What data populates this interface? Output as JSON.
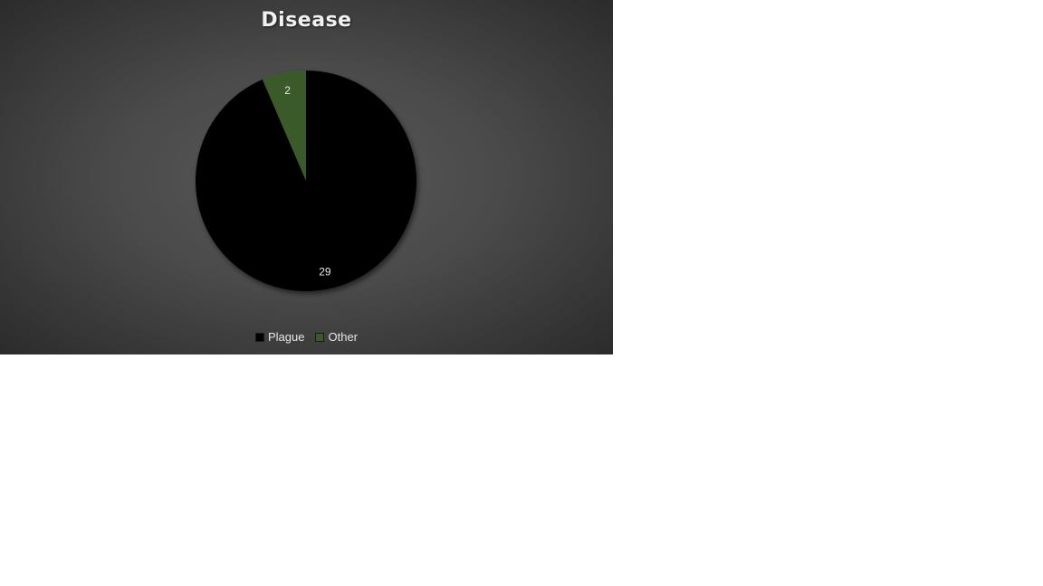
{
  "chart_data": {
    "type": "pie",
    "title": "Disease",
    "categories": [
      "Plague",
      "Other"
    ],
    "values": [
      29,
      2
    ],
    "data_labels": [
      "29",
      "2"
    ],
    "colors": [
      "#000000",
      "#3b5a2b"
    ],
    "legend_position": "bottom"
  }
}
